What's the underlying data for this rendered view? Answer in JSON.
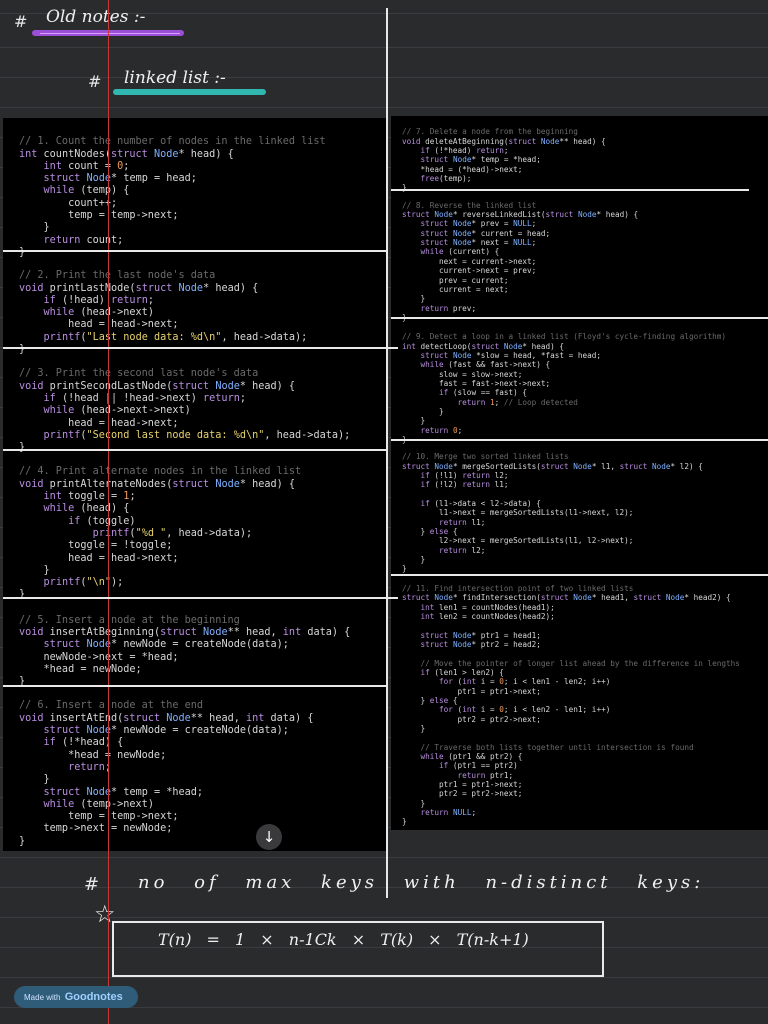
{
  "note": {
    "heading_hash": "#",
    "heading": "Old notes :-",
    "subheading_hash": "#",
    "subheading": "linked list :-"
  },
  "code_blocks_left": [
    "// 1. Count the number of nodes in the linked list\nint countNodes(struct Node* head) {\n    int count = 0;\n    struct Node* temp = head;\n    while (temp) {\n        count++;\n        temp = temp->next;\n    }\n    return count;\n}",
    "// 2. Print the last node's data\nvoid printLastNode(struct Node* head) {\n    if (!head) return;\n    while (head->next)\n        head = head->next;\n    printf(\"Last node data: %d\\n\", head->data);\n}",
    "// 3. Print the second last node's data\nvoid printSecondLastNode(struct Node* head) {\n    if (!head || !head->next) return;\n    while (head->next->next)\n        head = head->next;\n    printf(\"Second last node data: %d\\n\", head->data);\n}",
    "// 4. Print alternate nodes in the linked list\nvoid printAlternateNodes(struct Node* head) {\n    int toggle = 1;\n    while (head) {\n        if (toggle)\n            printf(\"%d \", head->data);\n        toggle = !toggle;\n        head = head->next;\n    }\n    printf(\"\\n\");\n}",
    "// 5. Insert a node at the beginning\nvoid insertAtBeginning(struct Node** head, int data) {\n    struct Node* newNode = createNode(data);\n    newNode->next = *head;\n    *head = newNode;\n}",
    "// 6. Insert a node at the end\nvoid insertAtEnd(struct Node** head, int data) {\n    struct Node* newNode = createNode(data);\n    if (!*head) {\n        *head = newNode;\n        return;\n    }\n    struct Node* temp = *head;\n    while (temp->next)\n        temp = temp->next;\n    temp->next = newNode;\n}"
  ],
  "code_blocks_right": [
    "// 7. Delete a node from the beginning\nvoid deleteAtBeginning(struct Node** head) {\n    if (!*head) return;\n    struct Node* temp = *head;\n    *head = (*head)->next;\n    free(temp);\n}",
    "// 8. Reverse the linked list\nstruct Node* reverseLinkedList(struct Node* head) {\n    struct Node* prev = NULL;\n    struct Node* current = head;\n    struct Node* next = NULL;\n    while (current) {\n        next = current->next;\n        current->next = prev;\n        prev = current;\n        current = next;\n    }\n    return prev;\n}",
    "// 9. Detect a loop in a linked list (Floyd's cycle-finding algorithm)\nint detectLoop(struct Node* head) {\n    struct Node *slow = head, *fast = head;\n    while (fast && fast->next) {\n        slow = slow->next;\n        fast = fast->next->next;\n        if (slow == fast) {\n            return 1; // Loop detected\n        }\n    }\n    return 0;\n}",
    "// 10. Merge two sorted linked lists\nstruct Node* mergeSortedLists(struct Node* l1, struct Node* l2) {\n    if (!l1) return l2;\n    if (!l2) return l1;\n\n    if (l1->data < l2->data) {\n        l1->next = mergeSortedLists(l1->next, l2);\n        return l1;\n    } else {\n        l2->next = mergeSortedLists(l1, l2->next);\n        return l2;\n    }\n}",
    "// 11. Find intersection point of two linked lists\nstruct Node* findIntersection(struct Node* head1, struct Node* head2) {\n    int len1 = countNodes(head1);\n    int len2 = countNodes(head2);\n\n    struct Node* ptr1 = head1;\n    struct Node* ptr2 = head2;\n\n    // Move the pointer of longer list ahead by the difference in lengths\n    if (len1 > len2) {\n        for (int i = 0; i < len1 - len2; i++)\n            ptr1 = ptr1->next;\n    } else {\n        for (int i = 0; i < len2 - len1; i++)\n            ptr2 = ptr2->next;\n    }\n\n    // Traverse both lists together until intersection is found\n    while (ptr1 && ptr2) {\n        if (ptr1 == ptr2)\n            return ptr1;\n        ptr1 = ptr1->next;\n        ptr2 = ptr2->next;\n    }\n    return NULL;\n}"
  ],
  "scroll_down_icon": "↓",
  "bottom_note": {
    "hash": "#",
    "text": "no of max keys with n-distinct keys:",
    "star": "☆",
    "formula": "T(n) = 1 × n-1Ck × T(k) × T(n-k+1)"
  },
  "branding": {
    "made_with": "Made with",
    "app_name": "Goodnotes"
  },
  "colors": {
    "page_bg": "#2a2b2d",
    "margin_line": "#c8373a",
    "heading_underline": "#9b4fd6",
    "subheading_underline": "#2fb7b0",
    "badge_bg": "#2f5c79"
  }
}
